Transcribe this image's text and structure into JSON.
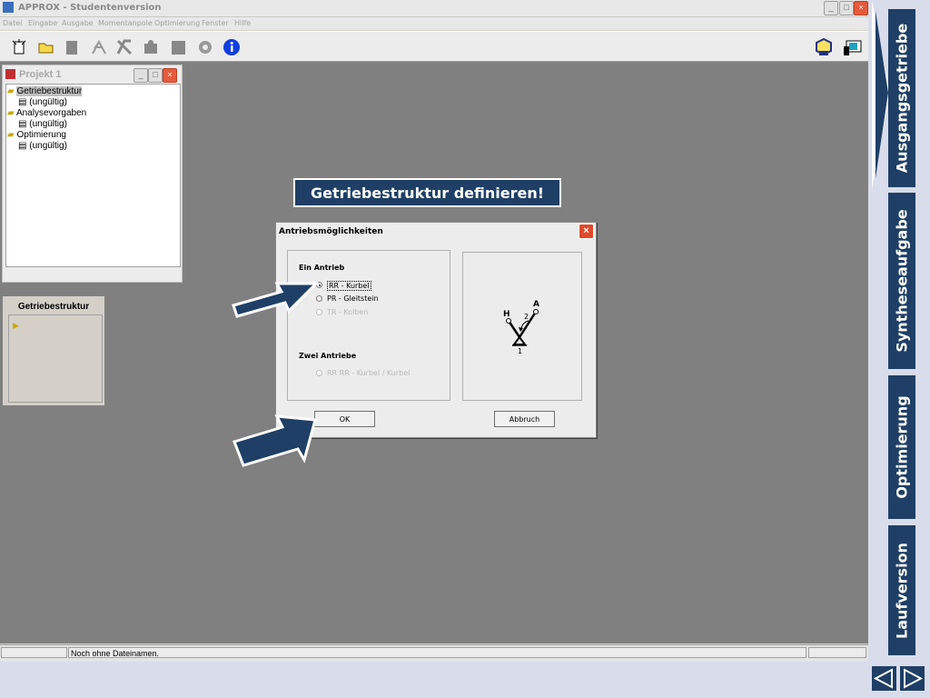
{
  "window": {
    "title": "APPROX - Studentenversion"
  },
  "menu": [
    "Datei",
    "Eingabe",
    "Ausgabe",
    "Momentanpole",
    "Optimierung",
    "Fenster",
    "Hilfe"
  ],
  "project": {
    "title": "Projekt 1",
    "tree": [
      {
        "label": "Getriebestruktur",
        "child": "(ungültig)"
      },
      {
        "label": "Analysevorgaben",
        "child": "(ungültig)"
      },
      {
        "label": "Optimierung",
        "child": "(ungültig)"
      }
    ]
  },
  "struct_panel": {
    "title": "Getriebestruktur"
  },
  "banner": "Getriebestruktur definieren!",
  "dialog": {
    "title": "Antriebsmöglichkeiten",
    "group1": "Ein Antrieb",
    "opt1": "RR - Kurbel",
    "opt2": "PR - Gleitstein",
    "opt3": "TR - Kolben",
    "group2": "Zwei Antriebe",
    "opt4": "RR RR - Kurbel / Kurbel",
    "ok": "OK",
    "cancel": "Abbruch",
    "diagram": {
      "h": "H",
      "a": "A",
      "n2": "2",
      "n1": "1"
    }
  },
  "status": {
    "text": "Noch ohne Dateinamen."
  },
  "side_tabs": [
    "Ausgangsgetriebe",
    "Syntheseaufgabe",
    "Optimierung",
    "Laufversion"
  ],
  "colors": {
    "accent": "#1f3f66",
    "workspace": "#808080"
  }
}
